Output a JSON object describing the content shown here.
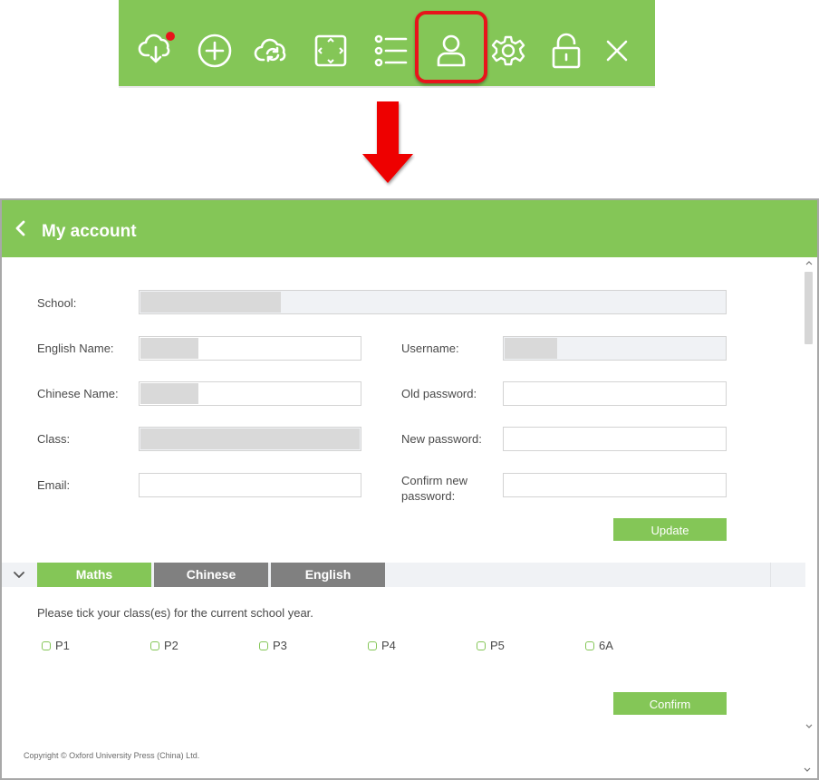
{
  "toolbar": {
    "icons": [
      "download-cloud-icon",
      "add-circle-icon",
      "cloud-sync-icon",
      "fullscreen-icon",
      "list-icon",
      "user-icon",
      "gear-icon",
      "unlock-icon",
      "close-icon"
    ],
    "highlighted": "user-icon",
    "colors": {
      "bar": "#84c657",
      "highlight": "#e8141b",
      "notification_dot": "#e8141b"
    }
  },
  "panel": {
    "title": "My account",
    "form": {
      "school_label": "School:",
      "english_name_label": "English Name:",
      "chinese_name_label": "Chinese Name:",
      "class_label": "Class:",
      "email_label": "Email:",
      "username_label": "Username:",
      "old_password_label": "Old password:",
      "new_password_label": "New password:",
      "confirm_new_label_line1": "Confirm new",
      "confirm_new_label_line2": "password:",
      "update_button": "Update"
    },
    "tabs": [
      {
        "label": "Maths",
        "active": true
      },
      {
        "label": "Chinese",
        "active": false
      },
      {
        "label": "English",
        "active": false
      }
    ],
    "class_prompt": "Please tick your class(es) for the current school year.",
    "classes": [
      "P1",
      "P2",
      "P3",
      "P4",
      "P5",
      "6A"
    ],
    "confirm_button": "Confirm",
    "copyright": "Copyright © Oxford University Press (China) Ltd."
  }
}
